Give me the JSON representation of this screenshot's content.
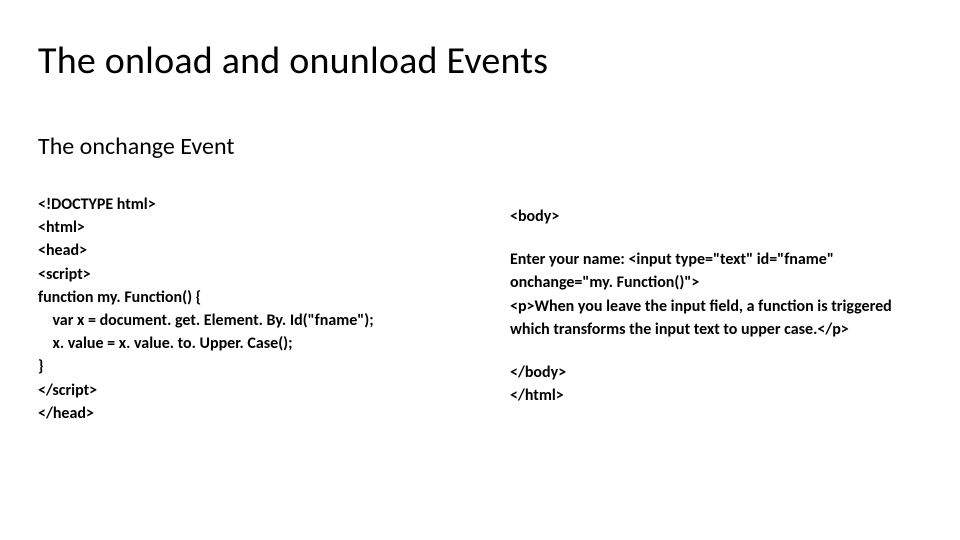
{
  "title": "The onload and onunload Events",
  "subtitle": "The onchange Event",
  "left": {
    "l1": "<!DOCTYPE html>",
    "l2": "<html>",
    "l3": "<head>",
    "l4": "<script>",
    "l5": "function my. Function() {",
    "l6": "    var x = document. get. Element. By. Id(\"fname\");",
    "l7": "    x. value = x. value. to. Upper. Case();",
    "l8": "}",
    "l9": "</script>",
    "l10": "</head>"
  },
  "right": {
    "l1": "<body>",
    "l2": "Enter your name: <input type=\"text\" id=\"fname\" onchange=\"my. Function()\">",
    "l3": "<p>When you leave the input field, a function is triggered which transforms the input text to upper case.</p>",
    "l4": "</body>",
    "l5": "</html>"
  }
}
